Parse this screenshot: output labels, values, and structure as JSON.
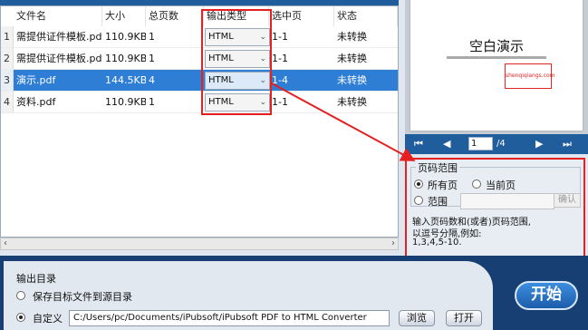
{
  "table": {
    "headers": [
      "文件名",
      "大小",
      "总页数",
      "输出类型",
      "选中页",
      "状态"
    ],
    "rows": [
      {
        "num": "1",
        "name": "需提供证件模板.pdf",
        "size": "110.9KB",
        "pages": "1",
        "type": "HTML",
        "selected": "1-1",
        "status": "未转换"
      },
      {
        "num": "2",
        "name": "需提供证件模板.pdf",
        "size": "110.9KB",
        "pages": "1",
        "type": "HTML",
        "selected": "1-1",
        "status": "未转换"
      },
      {
        "num": "3",
        "name": "演示.pdf",
        "size": "144.5KB",
        "pages": "4",
        "type": "HTML",
        "selected": "1-4",
        "status": "未转换"
      },
      {
        "num": "4",
        "name": "资料.pdf",
        "size": "110.9KB",
        "pages": "1",
        "type": "HTML",
        "selected": "1-1",
        "status": "未转换"
      }
    ],
    "selected_row": 3
  },
  "preview": {
    "title": "空白演示",
    "stamp": "shenqiqiangs.com",
    "current_page": "1",
    "total_pages": "/4"
  },
  "page_range": {
    "title": "页码范围",
    "all_pages": "所有页",
    "current_page": "当前页",
    "range": "范围",
    "confirm": "确认",
    "hint_line1": "输入页码数和(或者)页码范围,",
    "hint_line2": "以逗号分隔,例如:",
    "hint_line3": "1,3,4,5-10."
  },
  "output": {
    "label": "输出目录",
    "option_source": "保存目标文件到源目录",
    "option_custom": "自定义",
    "path": "C:/Users/pc/Documents/iPubsoft/iPubsoft PDF to HTML Converter",
    "browse": "浏览",
    "open": "打开",
    "start": "开始"
  },
  "colors": {
    "selection": "#2f7ed6",
    "highlight": "#e52020",
    "nav": "#1f5d9c",
    "start": "#1c5cab"
  }
}
